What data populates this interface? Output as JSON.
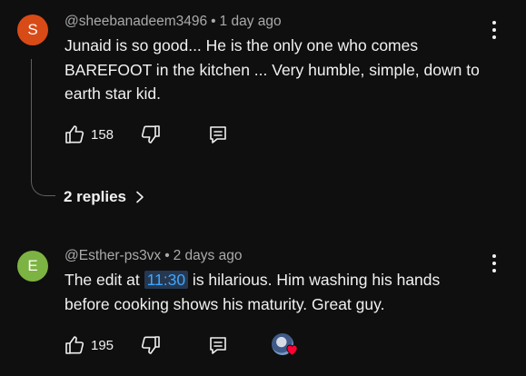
{
  "comments": [
    {
      "avatar_letter": "S",
      "avatar_color": "#d84b16",
      "handle": "@sheebanadeem3496",
      "separator": "•",
      "time": "1 day ago",
      "text": "Junaid is so good... He is the only one who comes\nBAREFOOT in the kitchen  ... Very humble, simple, down to\nearth star kid.",
      "likes": "158",
      "replies_label": "2 replies"
    },
    {
      "avatar_letter": "E",
      "avatar_color": "#7cb342",
      "handle": "@Esther-ps3vx",
      "separator": "•",
      "time": "2 days ago",
      "text_before": "The edit at ",
      "timestamp": "11:30",
      "text_after": " is hilarious. Him washing his hands\nbefore cooking shows his maturity. Great guy.",
      "likes": "195",
      "creator_heart": true
    }
  ],
  "colors": {
    "background": "#0f0f0f",
    "text": "#f1f1f1",
    "meta": "#aaaaaa",
    "link": "#3ea6ff",
    "heart": "#ff0033"
  },
  "icons": [
    "more-vert-icon",
    "thumbs-up-icon",
    "thumbs-down-icon",
    "reply-icon",
    "chevron-right-icon",
    "creator-heart-icon"
  ]
}
